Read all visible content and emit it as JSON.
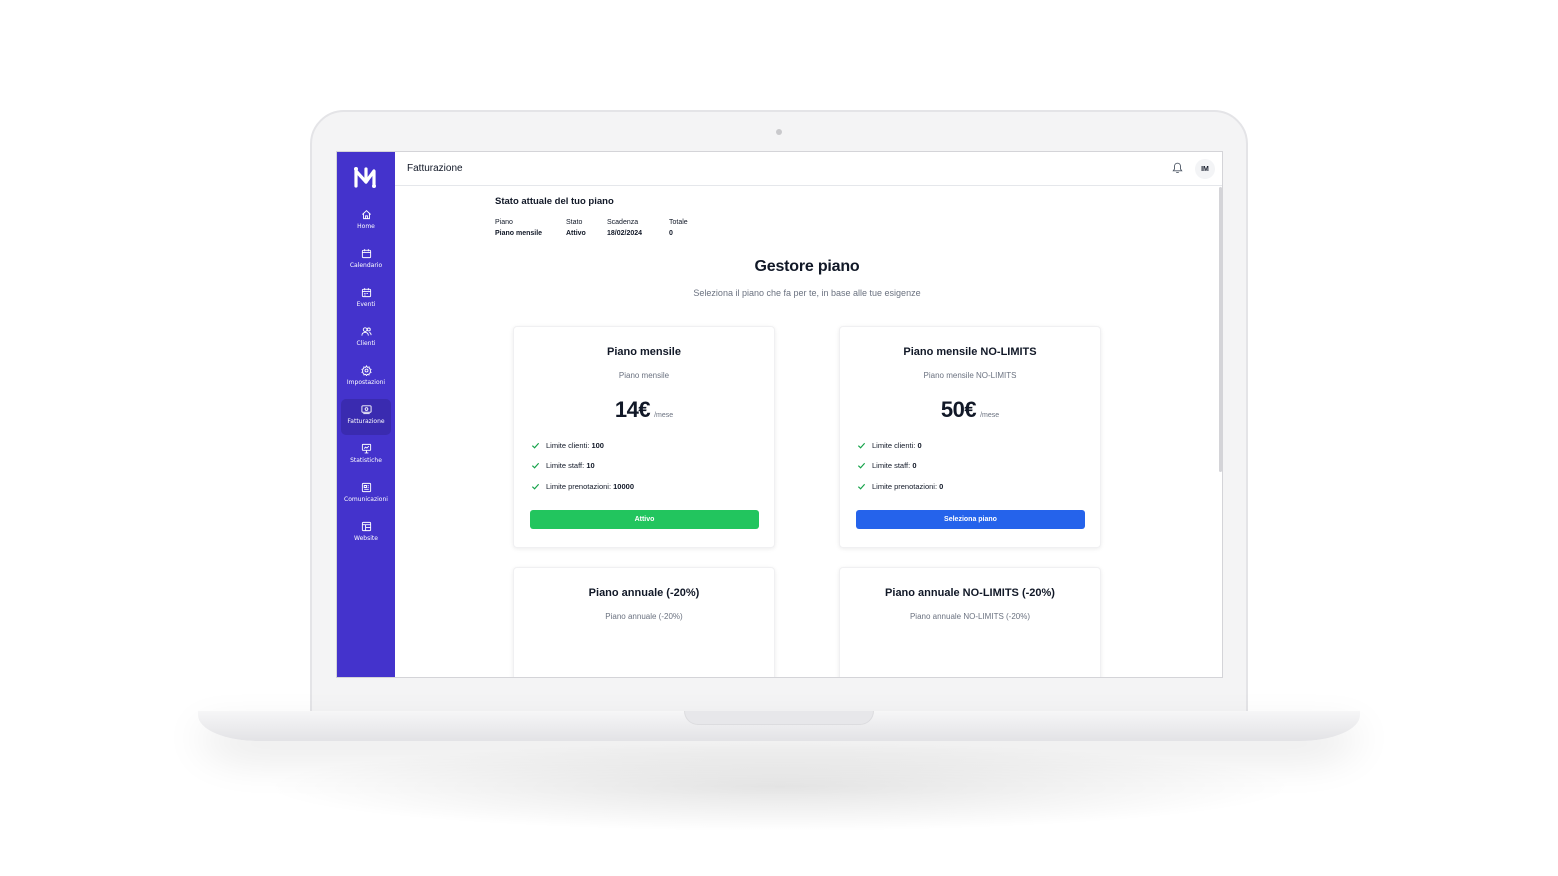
{
  "app": {
    "page_title": "Fatturazione",
    "user_initials": "IM"
  },
  "sidebar": {
    "items": [
      {
        "label": "Home",
        "icon": "home-icon"
      },
      {
        "label": "Calendario",
        "icon": "calendar-icon"
      },
      {
        "label": "Eventi",
        "icon": "calendar-event-icon"
      },
      {
        "label": "Clienti",
        "icon": "users-icon"
      },
      {
        "label": "Impostazioni",
        "icon": "gear-icon"
      },
      {
        "label": "Fatturazione",
        "icon": "billing-icon",
        "active": true
      },
      {
        "label": "Statistiche",
        "icon": "presentation-chart-icon"
      },
      {
        "label": "Comunicazioni",
        "icon": "newspaper-icon"
      },
      {
        "label": "Website",
        "icon": "layout-icon"
      }
    ]
  },
  "status": {
    "title": "Stato attuale del tuo piano",
    "columns": [
      {
        "label": "Piano",
        "value": "Piano mensile"
      },
      {
        "label": "Stato",
        "value": "Attivo"
      },
      {
        "label": "Scadenza",
        "value": "18/02/2024"
      },
      {
        "label": "Totale",
        "value": "0"
      }
    ]
  },
  "manager": {
    "heading": "Gestore piano",
    "subheading": "Seleziona il piano che fa per te, in base alle tue esigenze"
  },
  "plans": [
    {
      "title": "Piano mensile",
      "subtitle": "Piano mensile",
      "price": "14€",
      "period": "/mese",
      "features": [
        {
          "label": "Limite clienti:",
          "value": "100"
        },
        {
          "label": "Limite staff:",
          "value": "10"
        },
        {
          "label": "Limite prenotazioni:",
          "value": "10000"
        }
      ],
      "button": "Attivo"
    },
    {
      "title": "Piano mensile NO-LIMITS",
      "subtitle": "Piano mensile NO-LIMITS",
      "price": "50€",
      "period": "/mese",
      "features": [
        {
          "label": "Limite clienti:",
          "value": "0"
        },
        {
          "label": "Limite staff:",
          "value": "0"
        },
        {
          "label": "Limite prenotazioni:",
          "value": "0"
        }
      ],
      "button": "Seleziona piano"
    },
    {
      "title": "Piano annuale (-20%)",
      "subtitle": "Piano annuale (-20%)"
    },
    {
      "title": "Piano annuale NO-LIMITS (-20%)",
      "subtitle": "Piano annuale NO-LIMITS (-20%)"
    }
  ],
  "colors": {
    "sidebar": "#4433cc",
    "sidebar_active": "#3a2bb0",
    "active_button": "#22c55e",
    "select_button": "#2563eb",
    "check": "#16a34a"
  }
}
